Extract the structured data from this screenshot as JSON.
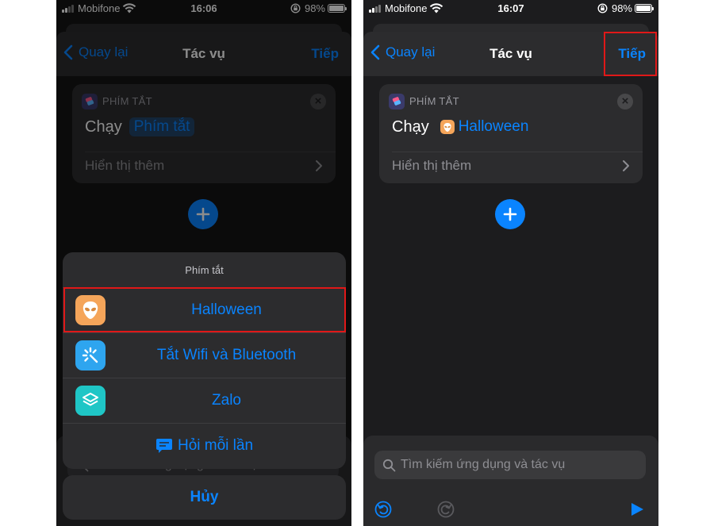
{
  "colors": {
    "accent": "#0a84ff",
    "highlight": "#e01818",
    "halloween_icon": "#f5a55a",
    "wifi_icon": "#2ea5ef",
    "zalo_icon": "#1fc6c6"
  },
  "left": {
    "status": {
      "carrier": "Mobifone",
      "time": "16:06",
      "battery": "98%"
    },
    "nav": {
      "back": "Quay lại",
      "title": "Tác vụ",
      "next": "Tiếp"
    },
    "card": {
      "app_label": "PHÍM TẮT",
      "run": "Chạy",
      "token": "Phím tắt",
      "more": "Hiển thị thêm"
    },
    "sheet": {
      "title": "Phím tắt",
      "items": [
        {
          "label": "Halloween",
          "icon": "alien-icon"
        },
        {
          "label": "Tắt Wifi và Bluetooth",
          "icon": "sparkle-icon"
        },
        {
          "label": "Zalo",
          "icon": "layers-icon"
        },
        {
          "label": "Hỏi mỗi lần",
          "icon": "chat-bubble-icon"
        }
      ],
      "cancel": "Hủy"
    }
  },
  "right": {
    "status": {
      "carrier": "Mobifone",
      "time": "16:07",
      "battery": "98%"
    },
    "nav": {
      "back": "Quay lại",
      "title": "Tác vụ",
      "next": "Tiếp"
    },
    "card": {
      "app_label": "PHÍM TẮT",
      "run": "Chạy",
      "token": "Halloween",
      "more": "Hiển thị thêm"
    },
    "search": {
      "placeholder": "Tìm kiếm ứng dụng và tác vụ"
    }
  }
}
